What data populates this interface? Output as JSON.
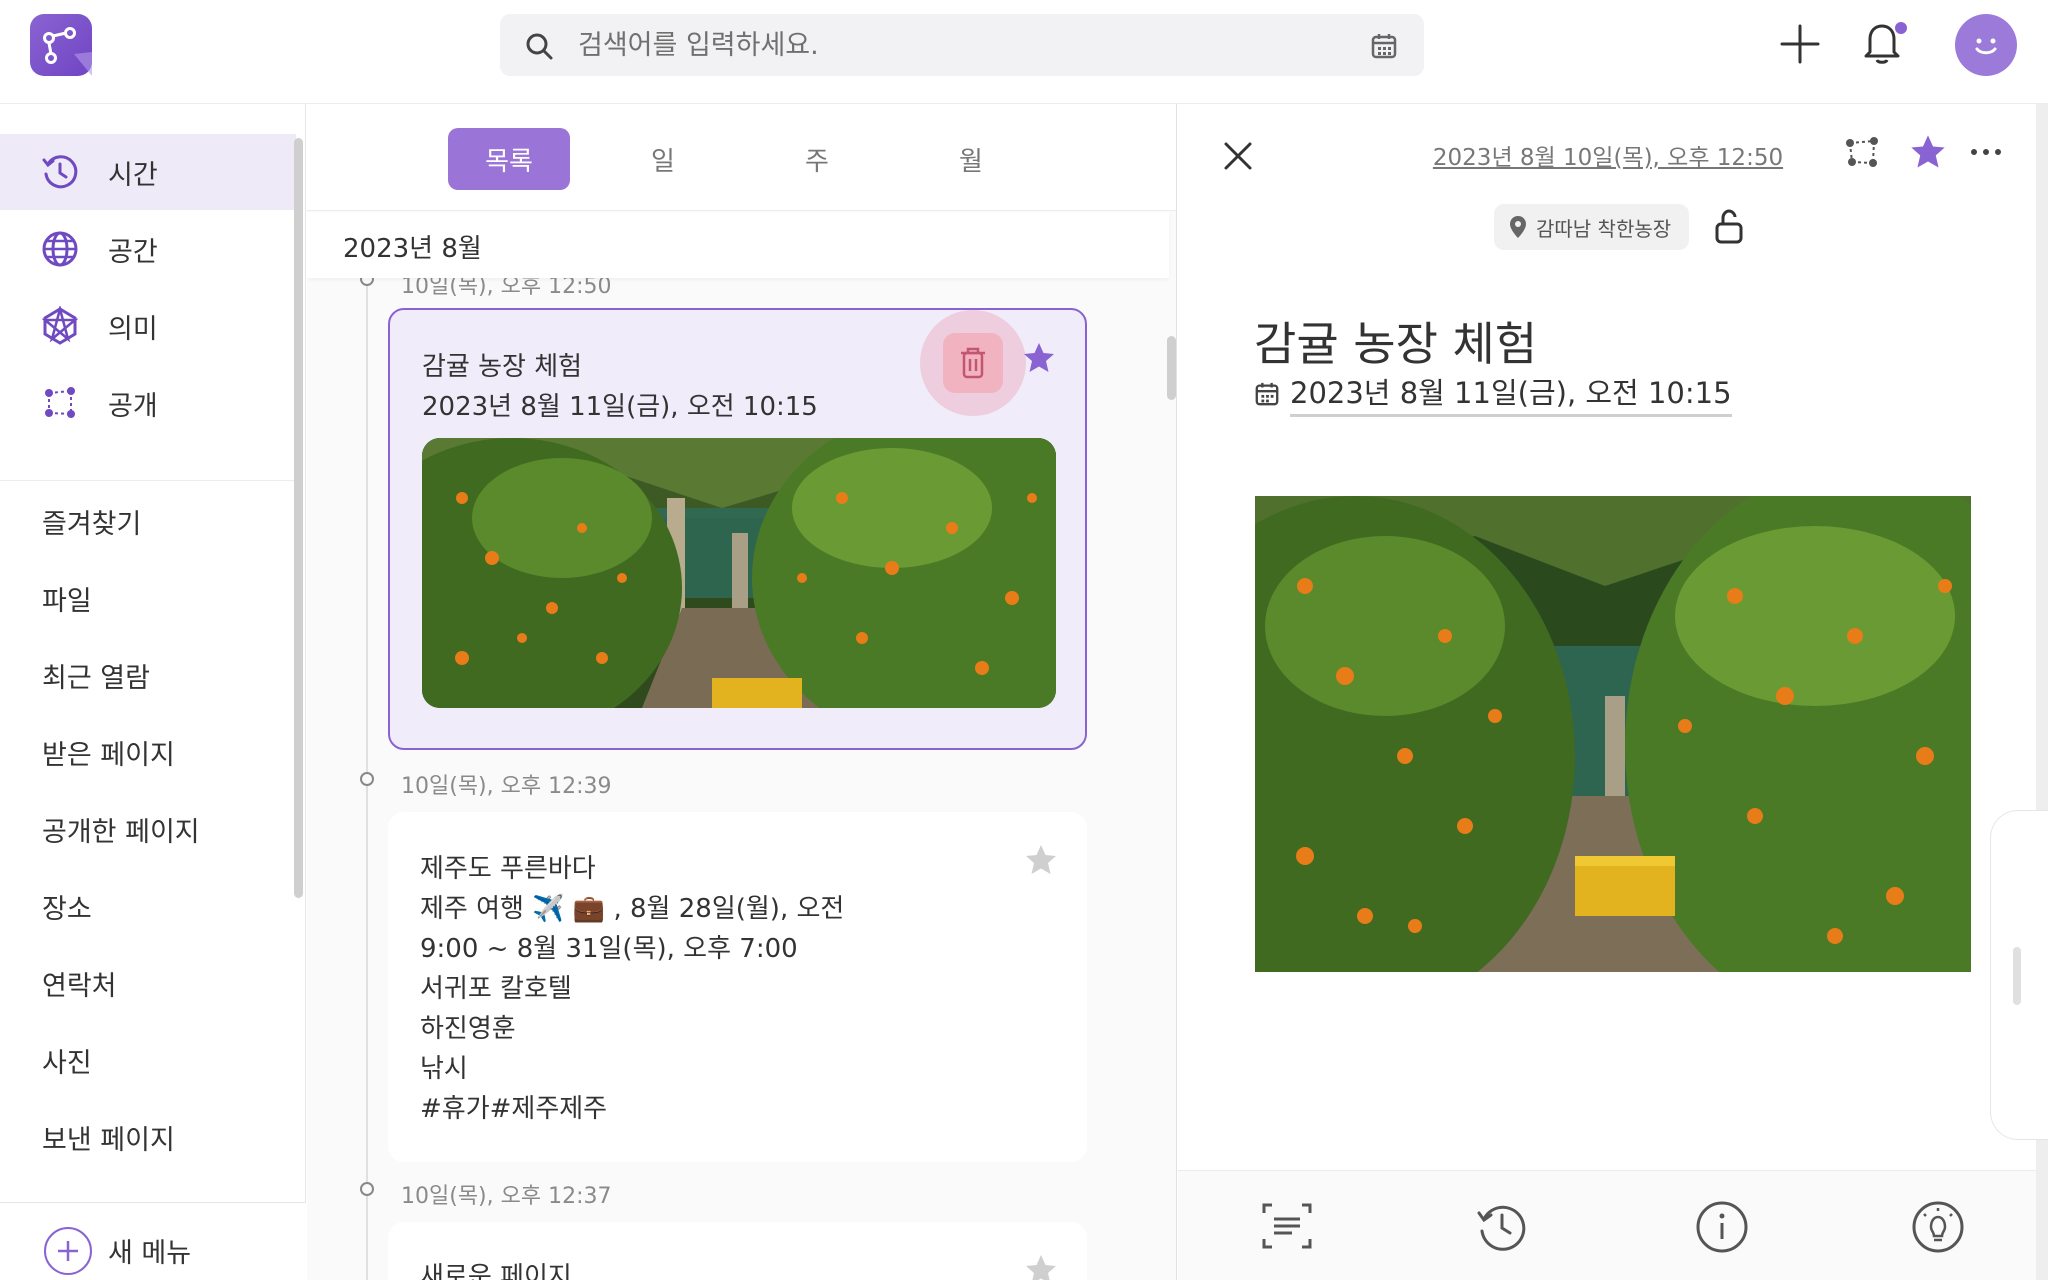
{
  "search": {
    "placeholder": "검색어를 입력하세요."
  },
  "sidebar": {
    "top_items": [
      {
        "label": "시간",
        "icon": "clock-history-icon"
      },
      {
        "label": "공간",
        "icon": "globe-icon"
      },
      {
        "label": "의미",
        "icon": "star-network-icon"
      },
      {
        "label": "공개",
        "icon": "share-network-icon"
      }
    ],
    "items": [
      "즐겨찾기",
      "파일",
      "최근 열람",
      "받은 페이지",
      "공개한 페이지",
      "장소",
      "연락처",
      "사진",
      "보낸 페이지"
    ],
    "new_menu_label": "새 메뉴"
  },
  "list": {
    "tabs": [
      "목록",
      "일",
      "주",
      "월"
    ],
    "active_tab": "목록",
    "month_label": "2023년 8월",
    "entries": [
      {
        "time": "10일(목), 오후 12:50",
        "title": "감귤 농장 체험",
        "lines": [
          "2023년 8월 11일(금), 오전 10:15"
        ],
        "starred": true,
        "selected": true
      },
      {
        "time": "10일(목), 오후 12:39",
        "title": "제주도 푸른바다",
        "lines": [
          "제주 여행 ✈️ 💼 , 8월 28일(월), 오전",
          "9:00 ~ 8월 31일(목), 오후 7:00",
          "서귀포 칼호텔",
          "하진영훈",
          "낚시",
          "#휴가#제주제주"
        ],
        "starred": false
      },
      {
        "time": "10일(목), 오후 12:37",
        "title": "새로운 페이지",
        "lines": [],
        "starred": false
      }
    ]
  },
  "detail": {
    "created": "2023년 8월 10일(목), 오후 12:50",
    "location": "감따남 착한농장",
    "title": "감귤 농장 체험",
    "when": "2023년 8월 11일(금), 오전 10:15"
  },
  "colors": {
    "accent": "#8a63d2",
    "accent_light": "#efeaf8",
    "trash_highlight": "#f2b3c0"
  }
}
